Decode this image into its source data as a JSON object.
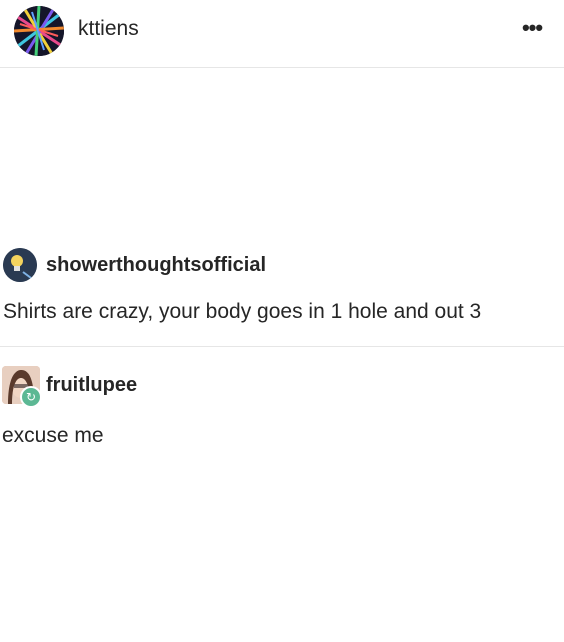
{
  "post": {
    "username": "kttiens",
    "more_label": "•••"
  },
  "embedded_posts": [
    {
      "author": "showerthoughtsofficial",
      "text": "Shirts are crazy, your body goes in 1 hole and out 3"
    },
    {
      "author": "fruitlupee",
      "text": "excuse me",
      "reblog_icon": "↻"
    }
  ],
  "colors": {
    "text": "#262626",
    "divider": "#e6e6e6",
    "reblog_badge": "#5cb894"
  }
}
